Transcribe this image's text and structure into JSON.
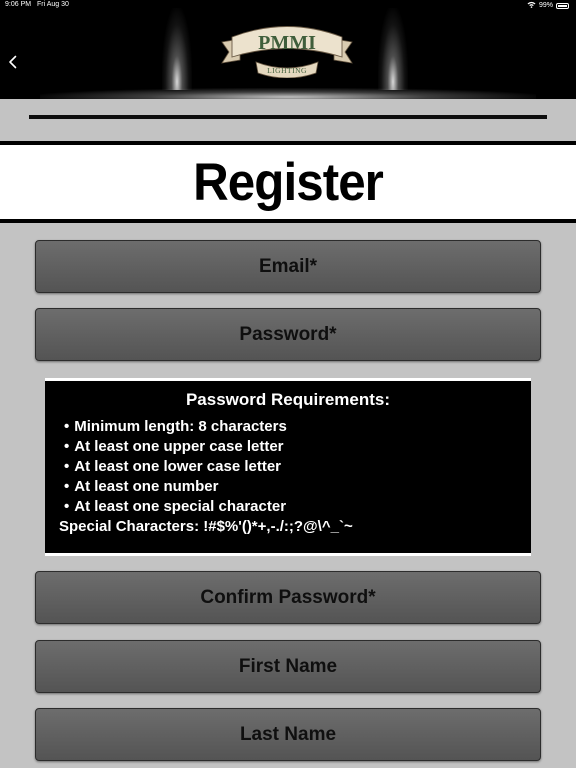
{
  "status_bar": {
    "time": "9:06 PM",
    "date": "Fri Aug 30",
    "battery": "99%"
  },
  "header": {
    "back_icon": "chevron-left-icon",
    "logo_top_text": "PMMI",
    "logo_bottom_text": "LIGHTING",
    "logo_ribbon_color": "#e8dcc4",
    "logo_text_color": "#3f5e3b"
  },
  "page": {
    "title": "Register"
  },
  "form": {
    "email_placeholder": "Email*",
    "password_placeholder": "Password*",
    "confirm_password_placeholder": "Confirm Password*",
    "first_name_placeholder": "First Name",
    "last_name_placeholder": "Last Name"
  },
  "password_requirements": {
    "title": "Password Requirements:",
    "items": [
      "Minimum length: 8 characters",
      "At least one upper case letter",
      "At least one lower case letter",
      "At least one number",
      "At least one special character"
    ],
    "special_characters": "Special Characters: !#$%'()*+,-./:;?@\\^_`~"
  },
  "colors": {
    "background": "#c3c3c3",
    "field_fill": "#5f5f5f",
    "header": "#000000"
  }
}
